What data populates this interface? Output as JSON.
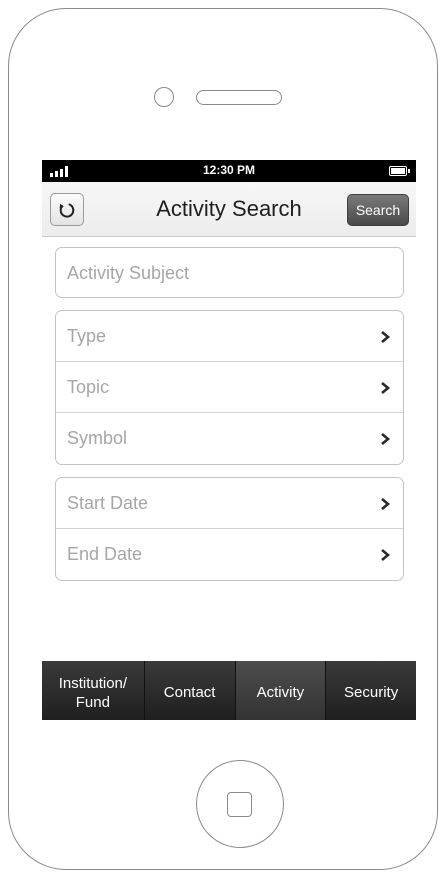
{
  "status_bar": {
    "time": "12:30 PM",
    "signal_icon": "signal-bars-icon",
    "battery_icon": "battery-icon"
  },
  "nav": {
    "title": "Activity Search",
    "search_label": "Search",
    "refresh_icon": "refresh-icon"
  },
  "form": {
    "subject_placeholder": "Activity Subject",
    "filter_rows": [
      {
        "label": "Type"
      },
      {
        "label": "Topic"
      },
      {
        "label": "Symbol"
      }
    ],
    "date_rows": [
      {
        "label": "Start Date"
      },
      {
        "label": "End Date"
      }
    ],
    "row_icon": "chevron-right-icon"
  },
  "tabs": [
    {
      "label": "Institution/ Fund"
    },
    {
      "label": "Contact"
    },
    {
      "label": "Activity",
      "active": true
    },
    {
      "label": "Security"
    }
  ],
  "device": {
    "home_button_icon": "home-button-icon"
  }
}
